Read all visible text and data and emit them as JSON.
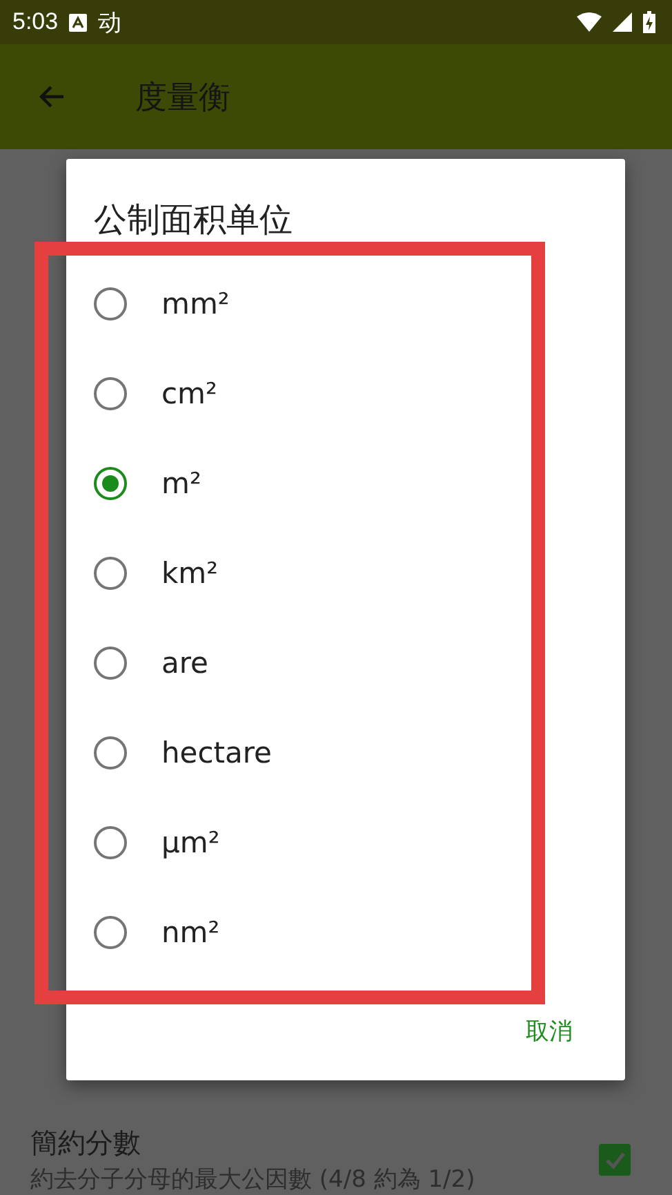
{
  "status_bar": {
    "time": "5:03",
    "notification_glyph": "动"
  },
  "app_bar": {
    "title": "度量衡"
  },
  "dialog": {
    "title": "公制面积单位",
    "options": [
      {
        "label": "mm²",
        "selected": false
      },
      {
        "label": "cm²",
        "selected": false
      },
      {
        "label": "m²",
        "selected": true
      },
      {
        "label": "km²",
        "selected": false
      },
      {
        "label": "are",
        "selected": false
      },
      {
        "label": "hectare",
        "selected": false
      },
      {
        "label": "µm²",
        "selected": false
      },
      {
        "label": "nm²",
        "selected": false
      }
    ],
    "cancel": "取消"
  },
  "setting": {
    "title": "簡約分數",
    "summary": "約去分子分母的最大公因數 (4/8 約為 1/2)",
    "checked": true
  }
}
